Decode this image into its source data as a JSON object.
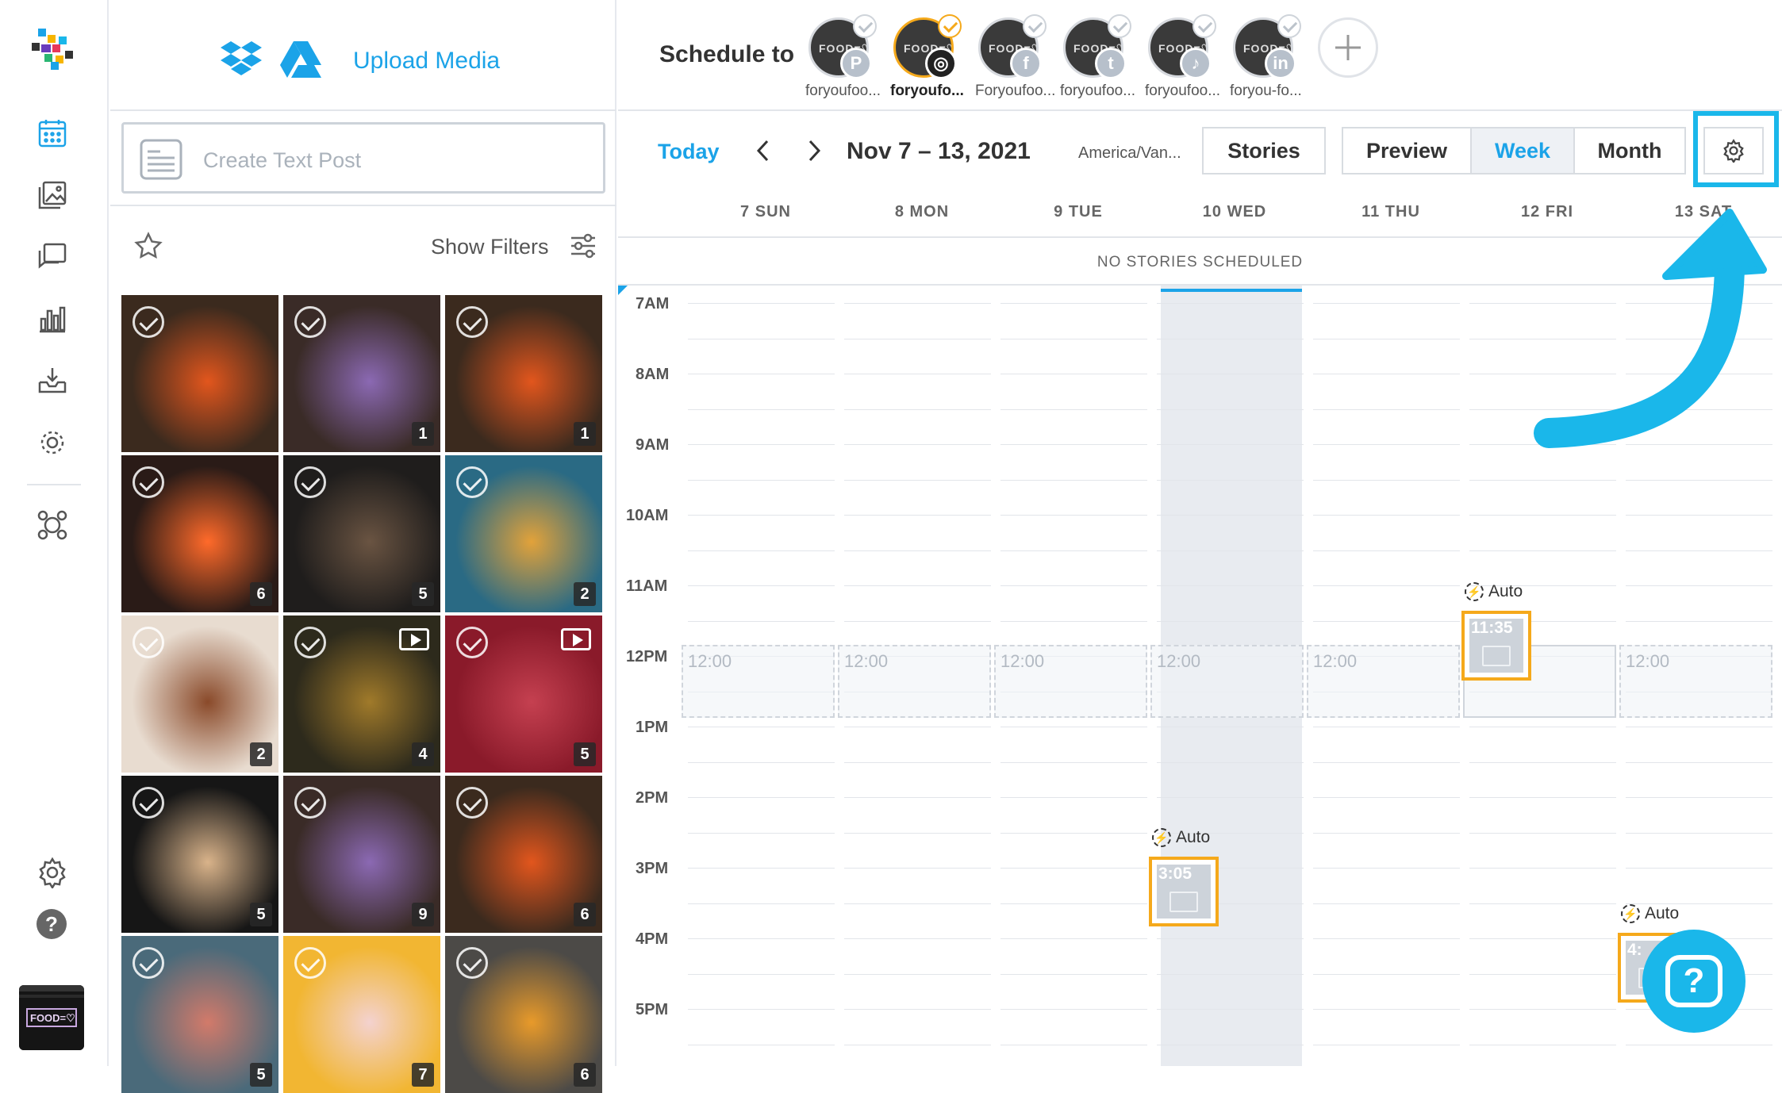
{
  "media_panel": {
    "upload_label": "Upload Media",
    "create_text_post": "Create Text Post",
    "show_filters": "Show Filters",
    "tiles": [
      {
        "count": "",
        "color": "#3b2a1e",
        "accent": "#e2561d",
        "video": false
      },
      {
        "count": "1",
        "color": "#3a2b27",
        "accent": "#8b69b3",
        "video": false
      },
      {
        "count": "1",
        "color": "#3b2a1e",
        "accent": "#e2561d",
        "video": false
      },
      {
        "count": "6",
        "color": "#2a1b17",
        "accent": "#ff6a2a",
        "video": false
      },
      {
        "count": "5",
        "color": "#1f1d1c",
        "accent": "#6a5442",
        "video": false
      },
      {
        "count": "2",
        "color": "#2a6a84",
        "accent": "#e2a23a",
        "video": false
      },
      {
        "count": "2",
        "color": "#e8dcd0",
        "accent": "#8a4a2a",
        "video": false
      },
      {
        "count": "4",
        "color": "#2d2a1c",
        "accent": "#a07a2a",
        "video": true
      },
      {
        "count": "5",
        "color": "#8a1a2a",
        "accent": "#c54050",
        "video": true
      },
      {
        "count": "5",
        "color": "#161616",
        "accent": "#d9b38a",
        "video": false
      },
      {
        "count": "9",
        "color": "#3a2b27",
        "accent": "#8b69b3",
        "video": false
      },
      {
        "count": "6",
        "color": "#3b2a1e",
        "accent": "#e2561d",
        "video": false
      },
      {
        "count": "5",
        "color": "#4a6a7a",
        "accent": "#d27a6a",
        "video": false
      },
      {
        "count": "7",
        "color": "#f2b632",
        "accent": "#f3d2cf",
        "video": false
      },
      {
        "count": "6",
        "color": "#4c4a47",
        "accent": "#e89a2a",
        "video": false
      }
    ]
  },
  "schedule": {
    "label": "Schedule to",
    "accounts": [
      {
        "name": "foryoufoo...",
        "network": "P",
        "selected": false
      },
      {
        "name": "foryoufo...",
        "network": "◎",
        "selected": true
      },
      {
        "name": "Foryoufoo...",
        "network": "f",
        "selected": false
      },
      {
        "name": "foryoufoo...",
        "network": "t",
        "selected": false
      },
      {
        "name": "foryoufoo...",
        "network": "♪",
        "selected": false
      },
      {
        "name": "foryou-fo...",
        "network": "in",
        "selected": false
      }
    ]
  },
  "toolbar": {
    "today": "Today",
    "date_range": "Nov 7 – 13, 2021",
    "timezone": "America/Van...",
    "stories": "Stories",
    "preview": "Preview",
    "week": "Week",
    "month": "Month"
  },
  "days": [
    "7 SUN",
    "8 MON",
    "9 TUE",
    "10 WED",
    "11 THU",
    "12 FRI",
    "13 SAT"
  ],
  "no_stories": "NO STORIES SCHEDULED",
  "hours": [
    "7AM",
    "8AM",
    "9AM",
    "10AM",
    "11AM",
    "12PM",
    "1PM",
    "2PM",
    "3PM",
    "4PM",
    "5PM"
  ],
  "slot_label": "12:00",
  "auto_label": "Auto",
  "posts": {
    "fri": "11:35",
    "wed": "3:05",
    "sat": "4:"
  },
  "rail": {
    "help": "?",
    "avatar_text": "FOOD=♡"
  },
  "help_float": "?",
  "colors": {
    "accent": "#1ba3e8",
    "highlight": "#1ab7ea",
    "post_border": "#f5a91b"
  }
}
